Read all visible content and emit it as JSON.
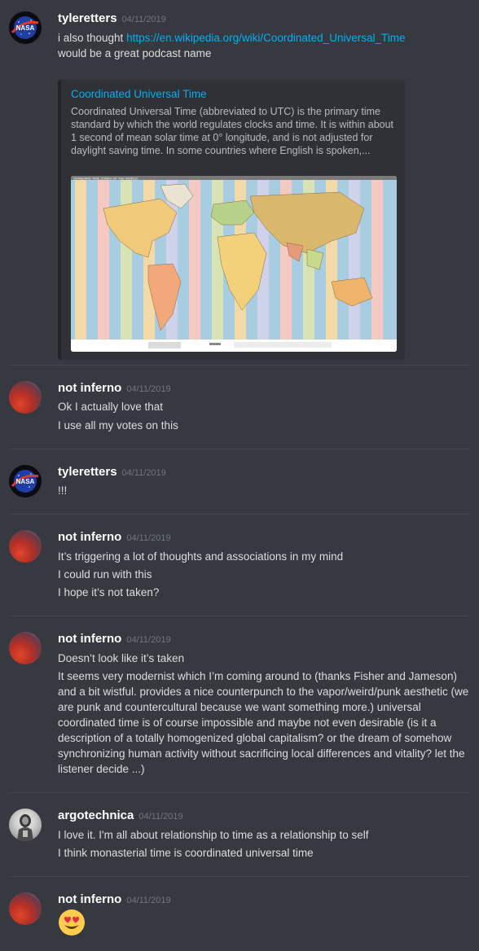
{
  "messages": [
    {
      "author": "tyleretters",
      "timestamp": "04/11/2019",
      "lines": [
        "i also thought ",
        "would be a great podcast name"
      ],
      "link": "https://en.wikipedia.org/wiki/Coordinated_Universal_Time",
      "embed": {
        "title": "Coordinated Universal Time",
        "description": "Coordinated Universal Time (abbreviated to UTC) is the primary time standard by which the world regulates clocks and time. It is within about 1 second of mean solar time at 0° longitude, and is not adjusted for daylight saving time. In some countries where English is spoken,...",
        "image_caption": "STANDARD TIME ZONES OF THE WORLD"
      }
    },
    {
      "author": "not inferno",
      "timestamp": "04/11/2019",
      "lines": [
        "Ok I actually love that",
        "I use all my votes on this"
      ]
    },
    {
      "author": "tyleretters",
      "timestamp": "04/11/2019",
      "lines": [
        "!!!"
      ]
    },
    {
      "author": "not inferno",
      "timestamp": "04/11/2019",
      "lines": [
        "It’s triggering a lot of thoughts and associations in my mind",
        "I could run with this",
        "I hope it’s not taken?"
      ]
    },
    {
      "author": "not inferno",
      "timestamp": "04/11/2019",
      "lines": [
        "Doesn’t look like it’s taken",
        "It seems very modernist which I’m coming around to (thanks Fisher and Jameson) and a bit wistful. provides a nice counterpunch to the vapor/weird/punk aesthetic (we are punk and countercultural because we want something more.) universal coordinated time is of course impossible and maybe not even desirable (is it a description of a totally homogenized global capitalism? or the dream of somehow synchronizing human activity without sacrificing local differences and vitality? let the listener decide ...)"
      ]
    },
    {
      "author": "argotechnica",
      "timestamp": "04/11/2019",
      "lines": [
        "I love it. I'm all about relationship to time as a relationship to self",
        "I think monasterial time is coordinated universal time"
      ]
    },
    {
      "author": "not inferno",
      "timestamp": "04/11/2019",
      "emoji": "heart-eyes-emoji"
    }
  ],
  "colors": {
    "background": "#36393f",
    "username": "#ffffff",
    "timestamp": "#72767d",
    "text": "#dcddde",
    "link": "#00b0f4",
    "embed_bg": "#2f3136"
  }
}
